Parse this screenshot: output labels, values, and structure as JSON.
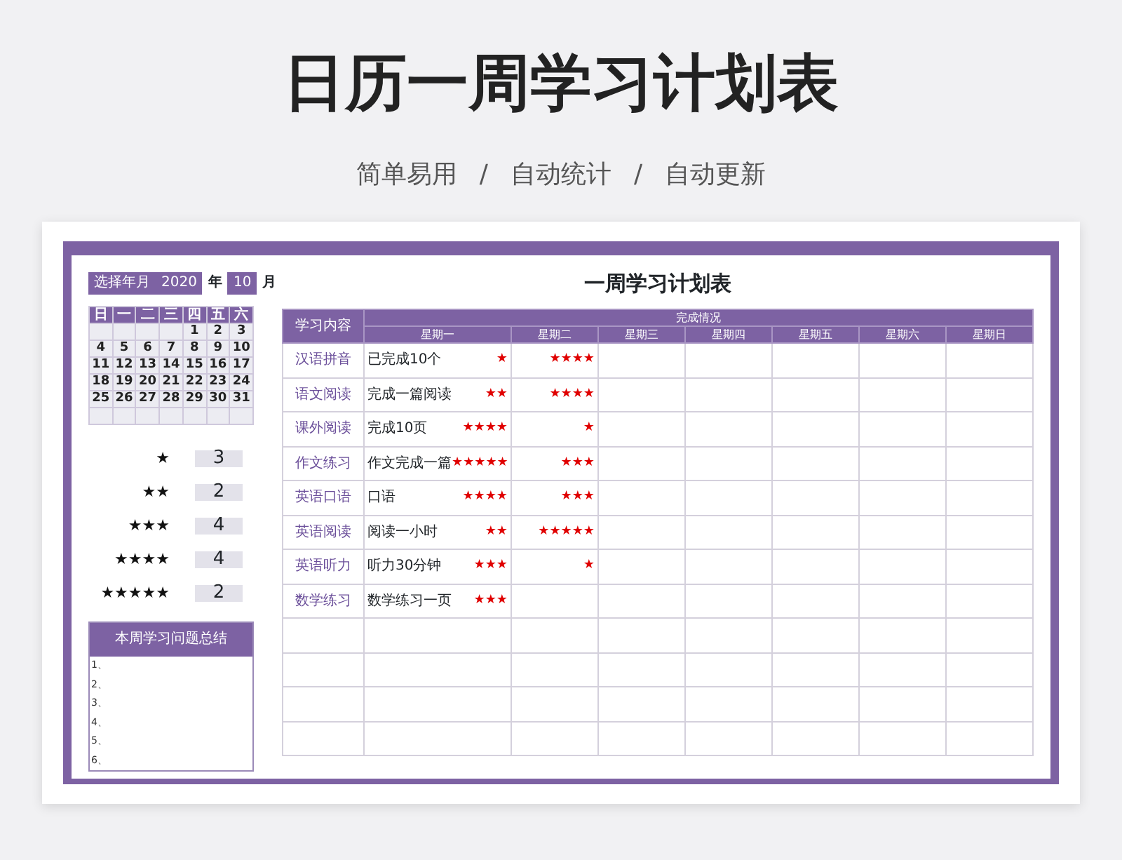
{
  "title": "日历一周学习计划表",
  "subtitle": [
    "简单易用",
    "/",
    "自动统计",
    "/",
    "自动更新"
  ],
  "calendar": {
    "label": "选择年月",
    "year": "2020",
    "year_unit": "年",
    "month": "10",
    "month_unit": "月",
    "weekdays": [
      "日",
      "一",
      "二",
      "三",
      "四",
      "五",
      "六"
    ],
    "weeks": [
      {
        "thu": "1",
        "fri": "2",
        "sat": "3"
      },
      {
        "sun": "4",
        "mon": "5",
        "tue": "6",
        "wed": "7",
        "thu": "8",
        "fri": "9",
        "sat": "10"
      },
      {
        "sun": "11",
        "mon": "12",
        "tue": "13",
        "wed": "14",
        "thu": "15",
        "fri": "16",
        "sat": "17"
      },
      {
        "sun": "18",
        "mon": "19",
        "tue": "20",
        "wed": "21",
        "thu": "22",
        "fri": "23",
        "sat": "24"
      },
      {
        "sun": "25",
        "mon": "26",
        "tue": "27",
        "wed": "28",
        "thu": "29",
        "fri": "30",
        "sat": "31"
      }
    ]
  },
  "star_summary": [
    {
      "rating": "★",
      "count": "3"
    },
    {
      "rating": "★★",
      "count": "2"
    },
    {
      "rating": "★★★",
      "count": "4"
    },
    {
      "rating": "★★★★",
      "count": "4"
    },
    {
      "rating": "★★★★★",
      "count": "2"
    }
  ],
  "notes": {
    "title": "本周学习问题总结",
    "lines": [
      "1、",
      "2、",
      "3、",
      "4、",
      "5、",
      "6、"
    ]
  },
  "plan": {
    "title": "一周学习计划表",
    "subject_header": "学习内容",
    "group_header": "完成情况",
    "days": [
      "星期一",
      "星期二",
      "星期三",
      "星期四",
      "星期五",
      "星期六",
      "星期日"
    ],
    "rows": [
      {
        "subject": "汉语拼音",
        "cells": [
          {
            "text": "已完成10个",
            "rating": "★"
          },
          {
            "rating": "★★★★"
          }
        ]
      },
      {
        "subject": "语文阅读",
        "cells": [
          {
            "text": "完成一篇阅读",
            "rating": "★★"
          },
          {
            "rating": "★★★★"
          }
        ]
      },
      {
        "subject": "课外阅读",
        "cells": [
          {
            "text": "完成10页",
            "rating": "★★★★"
          },
          {
            "rating": "★"
          }
        ]
      },
      {
        "subject": "作文练习",
        "cells": [
          {
            "text": "作文完成一篇",
            "rating": "★★★★★"
          },
          {
            "rating": "★★★"
          }
        ]
      },
      {
        "subject": "英语口语",
        "cells": [
          {
            "text": "口语",
            "rating": "★★★★"
          },
          {
            "rating": "★★★"
          }
        ]
      },
      {
        "subject": "英语阅读",
        "cells": [
          {
            "text": "阅读一小时",
            "rating": "★★"
          },
          {
            "rating": "★★★★★"
          }
        ]
      },
      {
        "subject": "英语听力",
        "cells": [
          {
            "text": "听力30分钟",
            "rating": "★★★"
          },
          {
            "rating": "★"
          }
        ]
      },
      {
        "subject": "数学练习",
        "cells": [
          {
            "text": "数学练习一页",
            "rating": "★★★"
          }
        ]
      },
      {},
      {},
      {},
      {}
    ]
  }
}
